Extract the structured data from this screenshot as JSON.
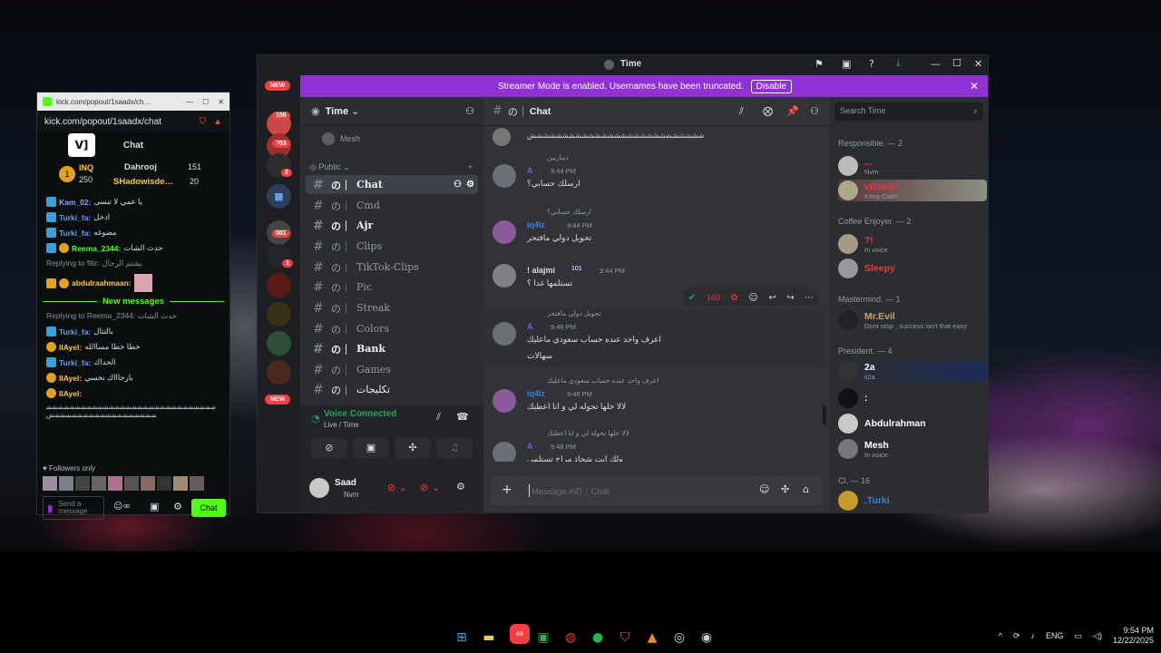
{
  "taskbar": {
    "time": "9:54 PM",
    "date": "12/22/2025",
    "lang": "ENG",
    "apps": [
      "windows-icon",
      "files-icon",
      "discord-icon",
      "terminal-icon",
      "chrome-icon",
      "spotify-icon",
      "brave-icon",
      "vlc-icon",
      "obs-icon",
      "steam-icon"
    ],
    "discord_badge": "69"
  },
  "kick": {
    "window_title": "kick.com/popout/1saadx/ch…",
    "url": "kick.com/popout/1saadx/chat",
    "chat_title": "Chat",
    "leaderboard": [
      {
        "name": "INQ",
        "points": "250"
      },
      {
        "name": "Dahrooj",
        "points": "151"
      },
      {
        "name": "SHadowisde…",
        "points": "20"
      }
    ],
    "messages": [
      {
        "user": "Kam_02:",
        "text": "يا عمي لا تنسى",
        "color": "#8fa4ff"
      },
      {
        "user": "Turki_fa:",
        "text": "ادخل",
        "color": "#5aa0ff"
      },
      {
        "user": "Turki_fa:",
        "text": "مضوغه",
        "color": "#5aa0ff"
      },
      {
        "user": "Reema_2344:",
        "text": "حدث الشات",
        "color": "#53fc18"
      },
      {
        "reply": "Replying to fttir: يشتم الرجال"
      },
      {
        "user": "abdulraahmaan:",
        "text": "",
        "color": "#f7c948"
      }
    ],
    "new_messages": "New messages",
    "reply2": "Replying to Reema_2344: حدث الشات",
    "messages2": [
      {
        "user": "Turki_fa:",
        "text": "بالتتال",
        "color": "#5aa0ff"
      },
      {
        "user": "IlAyel:",
        "text": "خطا خطا مساالله",
        "color": "#f7c948"
      },
      {
        "user": "Turki_fa:",
        "text": "الحداك",
        "color": "#5aa0ff"
      },
      {
        "user": "IlAyel:",
        "text": "بارجاااك نخسي",
        "color": "#f7c948"
      },
      {
        "user": "IlAyel:",
        "text": "ششششششششششششششششششششششششششششششششششششششششششششششششش",
        "color": "#f7c948"
      }
    ],
    "followers_only": "Followers only",
    "send_placeholder": "Send a message",
    "chat_button": "Chat"
  },
  "discord": {
    "window_title": "Time",
    "banner_text": "Streamer Mode is enabled. Usernames have been truncated.",
    "banner_button": "Disable",
    "guild_badges": {
      "new": "NEW",
      "g1": "156",
      "g2": "703",
      "g3": "2",
      "g4": "301",
      "g5": "1",
      "new2": "NEW"
    },
    "server_name": "Time",
    "category": "Public",
    "top_item": "Mesh",
    "channels": [
      "Chat",
      "Cmd",
      "Ajr",
      "Clips",
      "TikTok-Clips",
      "Pic",
      "Streak",
      "Colors",
      "Bank",
      "Games",
      "تكليجات"
    ],
    "voice": {
      "status": "Voice Connected",
      "place": "Live / Time"
    },
    "user": {
      "name": "Saad",
      "status": "Nvm"
    },
    "chat_header": "Chat",
    "search_placeholder": "Search Time",
    "message_placeholder": "Message #の｜Chat",
    "messages": [
      {
        "kind": "cont",
        "text": "ششششششششششششششششششششششششششش"
      },
      {
        "reply": "ديناريين",
        "name": "A",
        "time": "9:44 PM",
        "text": "ارسلك حسابي؟",
        "color": "#5865f2"
      },
      {
        "reply": "ارسلك حسابي؟",
        "name": "iq4lz",
        "time": "9:44 PM",
        "text": "تحويل دولي مافتحر",
        "color": "#3d80d9"
      },
      {
        "name": "! alajmi",
        "badge": "101",
        "time": "9:44 PM",
        "text": "تستلمها غدا ؟",
        "color": "#dbdee1"
      },
      {
        "reply": "تحويل دولي مافتحر",
        "name": "A",
        "time": "9:46 PM",
        "text": "اعرف واحد عنده حساب سعودي ماعليك",
        "text2": "سهالات",
        "color": "#5865f2"
      },
      {
        "reply": "اعرف واحد عنده حساب سعودي ماعليك",
        "name": "iq4lz",
        "time": "9:46 PM",
        "text": "لالا خلها تحوله لي و انا اعطيك",
        "color": "#3d80d9"
      },
      {
        "reply": "لالا خلها تحوله لي و انا اعطيك",
        "name": "A",
        "time": "9:48 PM",
        "text": "ولك انت شحاذ مراح تستلمي",
        "color": "#5865f2"
      }
    ],
    "member_groups": [
      {
        "title": "Responsible. — 2",
        "members": [
          {
            "name": "...",
            "status": "Nvm",
            "color": "#e8383d"
          },
          {
            "name": "vBakari",
            "status": "Keep Calm",
            "color": "#e8383d"
          }
        ]
      },
      {
        "title": "Coffee Enjoyer. — 2",
        "members": [
          {
            "name": "?!",
            "status": "In voice",
            "color": "#e8383d"
          },
          {
            "name": "Sleepy",
            "status": "",
            "color": "#e8383d"
          }
        ]
      },
      {
        "title": "Mastermind. — 1",
        "members": [
          {
            "name": "Mr.Evil",
            "status": "Dont stop , success isn't that easy",
            "color": "#c9a56b"
          }
        ]
      },
      {
        "title": "President. — 4",
        "members": [
          {
            "name": "2a",
            "status": "ii2a",
            "color": "#ffffff"
          },
          {
            "name": ":",
            "status": "",
            "color": "#ffffff"
          },
          {
            "name": "Abdulrahman",
            "status": "",
            "color": "#ffffff"
          },
          {
            "name": "Mesh",
            "status": "In voice",
            "color": "#ffffff"
          }
        ]
      },
      {
        "title": "Cl. — 16",
        "members": [
          {
            "name": ".Turki",
            "status": "",
            "color": "#3d80d9"
          }
        ]
      }
    ]
  }
}
